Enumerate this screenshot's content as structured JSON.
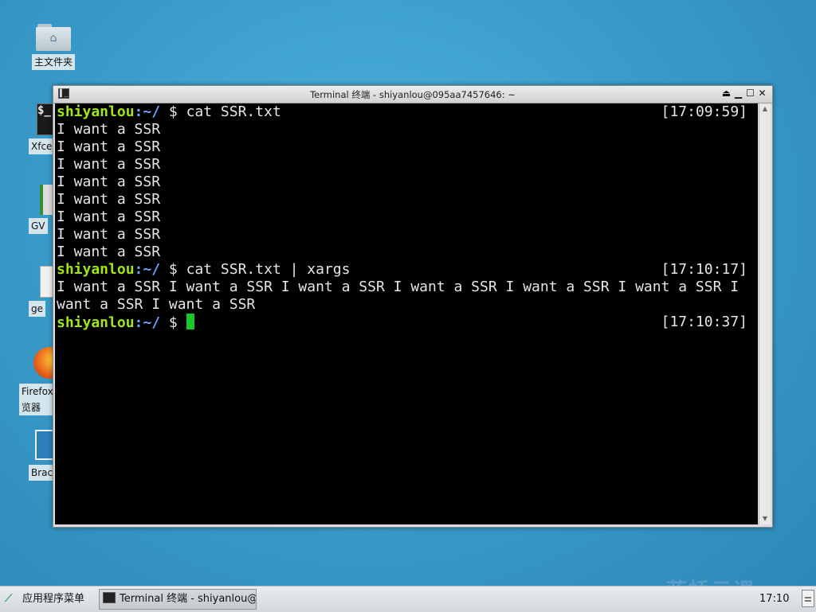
{
  "desktop": {
    "home_folder_label": "主文件夹",
    "side_icons": [
      "Xfce",
      "GV",
      "ge",
      "Firefox",
      "览器",
      "Brac"
    ]
  },
  "window": {
    "title": "Terminal 终端 - shiyanlou@095aa7457646: ~",
    "controls": [
      "⏏",
      "▁",
      "☐",
      "✕"
    ]
  },
  "terminal": {
    "user": "shiyanlou",
    "path": ":~/",
    "prompt_symbol": " $ ",
    "commands": [
      {
        "cmd": "cat SSR.txt",
        "timestamp": "[17:09:59]"
      },
      {
        "cmd": "cat SSR.txt | xargs",
        "timestamp": "[17:10:17]"
      },
      {
        "cmd": "",
        "timestamp": "[17:10:37]"
      }
    ],
    "output_lines": [
      "I want a SSR",
      "I want a SSR",
      "I want a SSR",
      "I want a SSR",
      "I want a SSR",
      "I want a SSR",
      "I want a SSR",
      "I want a SSR"
    ],
    "xargs_output": [
      "I want a SSR I want a SSR I want a SSR I want a SSR I want a SSR I want a SSR I",
      "want a SSR I want a SSR"
    ]
  },
  "taskbar": {
    "menu_label": "应用程序菜单",
    "task_label": "Terminal 终端 - shiyanlou@…",
    "clock": "17:10"
  },
  "watermark": "蓝桥云课"
}
